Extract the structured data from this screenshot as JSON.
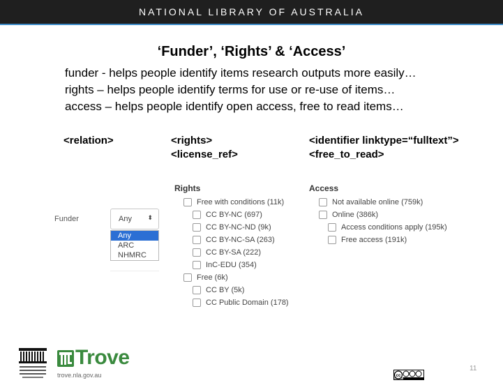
{
  "header": {
    "title": "NATIONAL LIBRARY OF AUSTRALIA"
  },
  "slide": {
    "title": "‘Funder’, ‘Rights’ & ‘Access’",
    "lines": [
      "funder - helps people identify items research outputs more easily…",
      "rights – helps people identify terms for use or re-use of items…",
      "access – helps people identify open access, free to read items…"
    ],
    "tags": {
      "relation": "<relation>",
      "rights": "<rights>",
      "license_ref": "<license_ref>",
      "identifier": "<identifier linktype=“fulltext”>",
      "free_to_read": "<free_to_read>"
    }
  },
  "funder": {
    "label": "Funder",
    "selected": "Any",
    "options": [
      "Any",
      "ARC",
      "NHMRC"
    ]
  },
  "rights": {
    "heading": "Rights",
    "items": [
      "Free with conditions (11k)",
      "CC BY-NC (697)",
      "CC BY-NC-ND (9k)",
      "CC BY-NC-SA (263)",
      "CC BY-SA (222)",
      "InC-EDU (354)",
      "Free (6k)",
      "CC BY (5k)",
      "CC Public Domain (178)"
    ]
  },
  "access": {
    "heading": "Access",
    "items": [
      "Not available online (759k)",
      "Online (386k)",
      "Access conditions apply (195k)",
      "Free access (191k)"
    ]
  },
  "footer": {
    "logo_text": "NATIONAL LIBRARY OF AUSTRALIA",
    "trove": "Trove",
    "url": "trove.nla.gov.au",
    "license_badge": "cc by nc sa",
    "page_number": "11"
  },
  "colors": {
    "header_bg": "#1f1f1f",
    "trove_green": "#3a8a3e",
    "select_highlight": "#2b6fd4"
  }
}
